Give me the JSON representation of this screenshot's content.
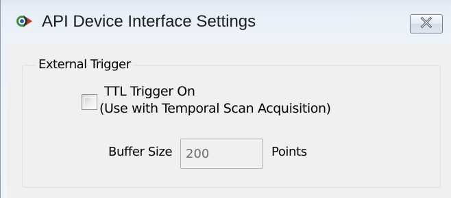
{
  "window": {
    "title": "API Device Interface Settings",
    "icon": "app-icon",
    "close_icon": "close-icon"
  },
  "external_trigger": {
    "group_label": "External Trigger",
    "ttl_checkbox": {
      "checked": false,
      "label_line1": "TTL Trigger On",
      "label_line2": "(Use with Temporal Scan Acquisition)"
    },
    "buffer_size": {
      "label": "Buffer Size",
      "value": "200",
      "units": "Points",
      "enabled": false
    }
  },
  "colors": {
    "title_bar_top": "#dfe8f2",
    "client_background": "#f0f0f0",
    "disabled_text": "#6d6d6d",
    "groupbox_border": "#d5dfe5"
  }
}
